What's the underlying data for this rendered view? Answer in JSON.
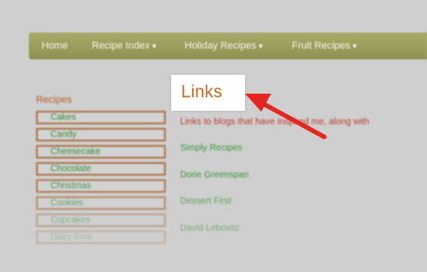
{
  "nav": {
    "items": [
      {
        "label": "Home",
        "caret": false
      },
      {
        "label": "Recipe Index",
        "caret": true
      },
      {
        "label": "Holiday Recipes",
        "caret": true
      },
      {
        "label": "Fruit Recipes",
        "caret": true
      }
    ]
  },
  "sidebar": {
    "title": "Recipes",
    "items": [
      "Cakes",
      "Candy",
      "Cheesecake",
      "Chocolate",
      "Christmas",
      "Cookies",
      "Cupcakes",
      "Dairy Free"
    ]
  },
  "main": {
    "heading": "Links",
    "intro": "Links to blogs that have inspired me,  along with",
    "links": [
      "Simply Recipes",
      "Dorie Greenspan",
      "Dessert First",
      "David Lebovitz"
    ]
  },
  "colors": {
    "nav_bg": "#9fa15f",
    "heading": "#c9661f",
    "link": "#3b9a3b",
    "arrow": "#e3261f"
  }
}
